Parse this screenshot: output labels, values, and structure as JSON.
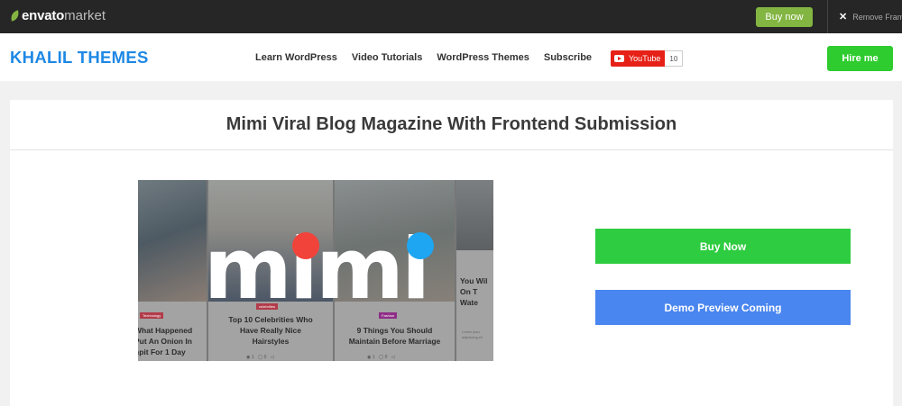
{
  "envato_bar": {
    "logo_part1": "envato",
    "logo_part2": "market",
    "buy_now_label": "Buy now",
    "remove_frame_label": "Remove Frame",
    "colors": {
      "background": "#262626",
      "accent": "#82b541"
    }
  },
  "header": {
    "site_logo": "KHALIL THEMES",
    "nav": [
      {
        "label": "Learn WordPress"
      },
      {
        "label": "Video Tutorials"
      },
      {
        "label": "WordPress Themes"
      },
      {
        "label": "Subscribe"
      }
    ],
    "youtube": {
      "label": "YouTube",
      "count": "10"
    },
    "hire_me_label": "Hire me",
    "colors": {
      "logo": "#1e88e5",
      "hire_me": "#2ecc2e",
      "youtube": "#e62117"
    }
  },
  "main": {
    "title": "Mimi Viral Blog Magazine With Frontend Submission",
    "preview": {
      "wordmark": "mimi",
      "cards": [
        {
          "tag": "Technology",
          "title_lines": [
            "What Happened",
            "Put An Onion In",
            "npit For 1 Day"
          ]
        },
        {
          "tag": "celebrities",
          "title_lines": [
            "Top 10 Celebrities Who",
            "Have Really Nice",
            "Hairstyles"
          ]
        },
        {
          "tag": "Fashion",
          "title_lines": [
            "9 Things You Should",
            "Maintain Before Marriage"
          ]
        },
        {
          "title_lines": [
            "You Wil",
            "On T",
            "Wate"
          ],
          "excerpt": "Lorem ipsu adipiscing eli"
        }
      ],
      "dot_colors": {
        "red": "#f1433a",
        "blue": "#1ea6f2"
      }
    },
    "buy_now_label": "Buy Now",
    "demo_label": "Demo Preview Coming",
    "colors": {
      "buy_now": "#2ecc40",
      "demo": "#4a86ef"
    }
  }
}
